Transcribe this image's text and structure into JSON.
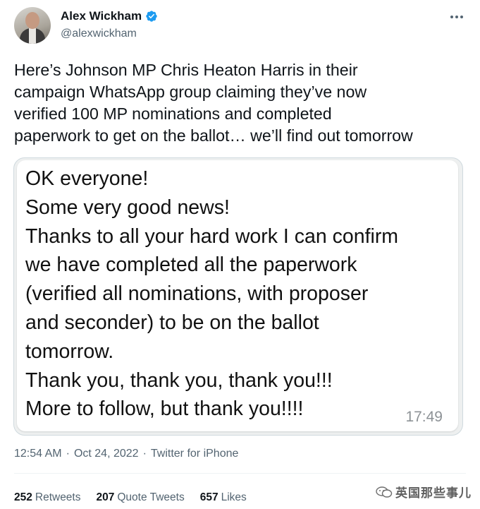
{
  "author": {
    "name": "Alex Wickham",
    "handle": "@alexwickham",
    "verified_color": "#1d9bf0"
  },
  "tweet": {
    "lines": [
      "Here’s Johnson MP Chris Heaton Harris in their",
      "campaign WhatsApp group claiming they’ve now",
      "verified 100 MP nominations and completed",
      "paperwork to get on the ballot… we’ll find out tomorrow"
    ]
  },
  "media": {
    "message_lines": [
      "OK everyone!",
      "Some very good news!",
      "Thanks to all your hard work I can confirm",
      "we have completed all the paperwork",
      "(verified all nominations, with proposer",
      "and seconder) to be on the ballot",
      "tomorrow.",
      "Thank you, thank you, thank you!!!",
      "More to follow, but thank you!!!!"
    ],
    "time": "17:49"
  },
  "meta": {
    "time": "12:54 AM",
    "date": "Oct 24, 2022",
    "source": "Twitter for iPhone",
    "separator": "·"
  },
  "stats": {
    "retweets_count": "252",
    "retweets_label": "Retweets",
    "quotes_count": "207",
    "quotes_label": "Quote Tweets",
    "likes_count": "657",
    "likes_label": "Likes"
  },
  "watermark": {
    "text": "英国那些事儿"
  },
  "icons": {
    "verified": "verified-badge-icon",
    "more": "more-options-icon",
    "watermark": "wechat-icon"
  }
}
